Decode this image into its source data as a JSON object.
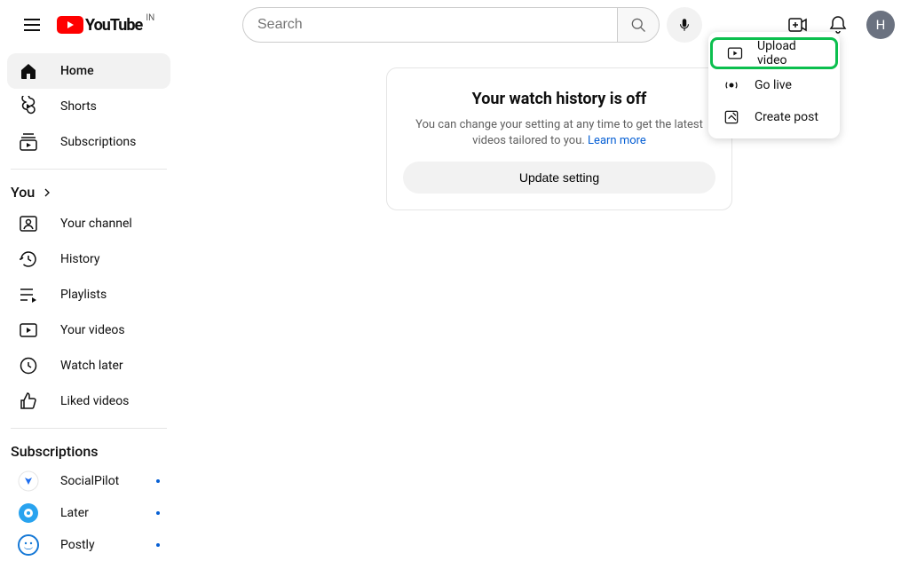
{
  "logo": {
    "brand": "YouTube",
    "country": "IN"
  },
  "search": {
    "placeholder": "Search"
  },
  "avatar": {
    "initial": "H"
  },
  "sidebar": {
    "main": [
      {
        "label": "Home"
      },
      {
        "label": "Shorts"
      },
      {
        "label": "Subscriptions"
      }
    ],
    "you_label": "You",
    "you": [
      {
        "label": "Your channel"
      },
      {
        "label": "History"
      },
      {
        "label": "Playlists"
      },
      {
        "label": "Your videos"
      },
      {
        "label": "Watch later"
      },
      {
        "label": "Liked videos"
      }
    ],
    "subs_label": "Subscriptions",
    "subs": [
      {
        "label": "SocialPilot"
      },
      {
        "label": "Later"
      },
      {
        "label": "Postly"
      }
    ]
  },
  "watch": {
    "title": "Your watch history is off",
    "desc": "You can change your setting at any time to get the latest videos tailored to you. ",
    "learn": "Learn more",
    "button": "Update setting"
  },
  "create_menu": {
    "items": [
      {
        "label": "Upload video"
      },
      {
        "label": "Go live"
      },
      {
        "label": "Create post"
      }
    ]
  }
}
